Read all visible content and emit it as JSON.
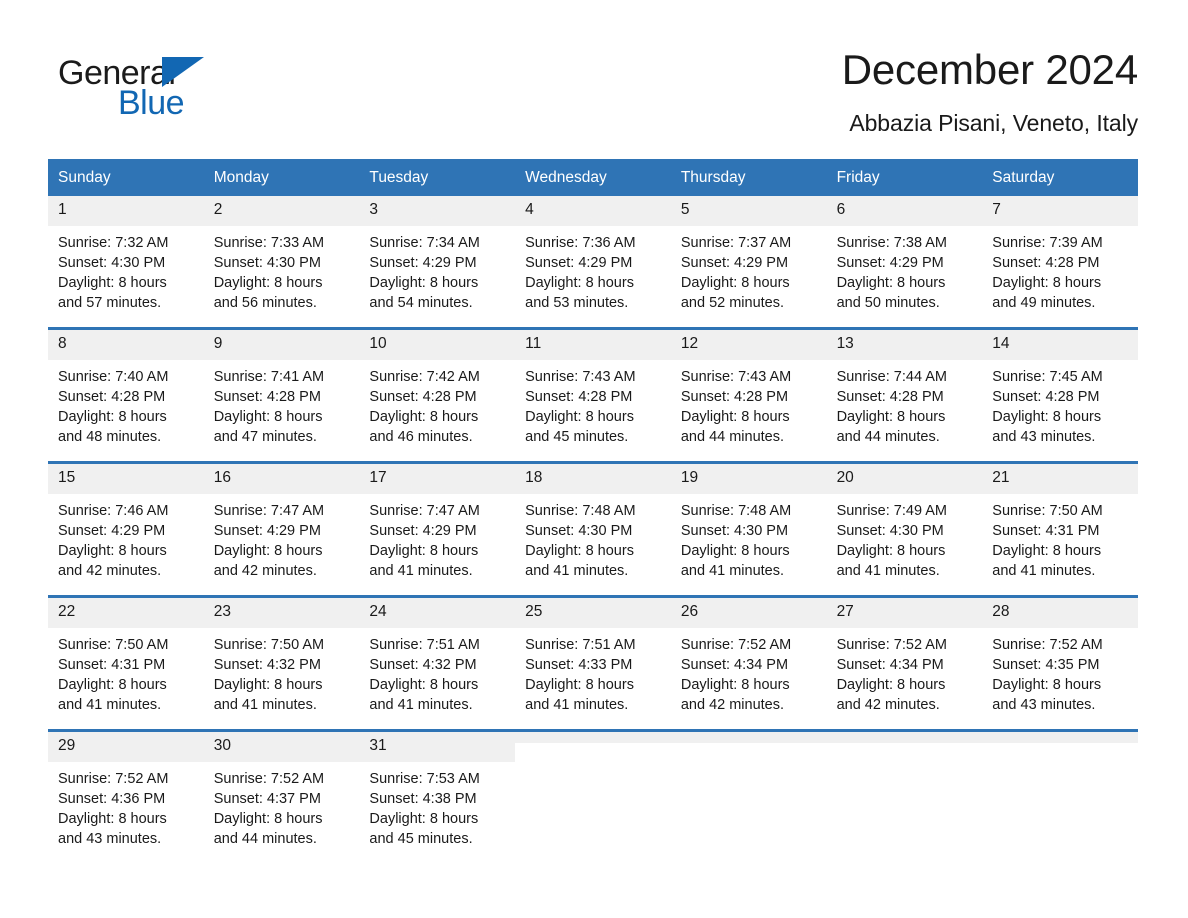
{
  "brand": {
    "word_one": "General",
    "word_two": "Blue",
    "triangle_icon": "brand-triangle-icon",
    "accent_color": "#1267b3"
  },
  "header": {
    "title": "December 2024",
    "subtitle": "Abbazia Pisani, Veneto, Italy"
  },
  "theme": {
    "header_blue": "#2f74b5",
    "day_band_gray": "#f0f0f0",
    "text": "#1a1a1a"
  },
  "calendar": {
    "weekday_headers": [
      "Sunday",
      "Monday",
      "Tuesday",
      "Wednesday",
      "Thursday",
      "Friday",
      "Saturday"
    ],
    "weeks": [
      [
        {
          "day": "1",
          "lines": [
            "Sunrise: 7:32 AM",
            "Sunset: 4:30 PM",
            "Daylight: 8 hours",
            "and 57 minutes."
          ]
        },
        {
          "day": "2",
          "lines": [
            "Sunrise: 7:33 AM",
            "Sunset: 4:30 PM",
            "Daylight: 8 hours",
            "and 56 minutes."
          ]
        },
        {
          "day": "3",
          "lines": [
            "Sunrise: 7:34 AM",
            "Sunset: 4:29 PM",
            "Daylight: 8 hours",
            "and 54 minutes."
          ]
        },
        {
          "day": "4",
          "lines": [
            "Sunrise: 7:36 AM",
            "Sunset: 4:29 PM",
            "Daylight: 8 hours",
            "and 53 minutes."
          ]
        },
        {
          "day": "5",
          "lines": [
            "Sunrise: 7:37 AM",
            "Sunset: 4:29 PM",
            "Daylight: 8 hours",
            "and 52 minutes."
          ]
        },
        {
          "day": "6",
          "lines": [
            "Sunrise: 7:38 AM",
            "Sunset: 4:29 PM",
            "Daylight: 8 hours",
            "and 50 minutes."
          ]
        },
        {
          "day": "7",
          "lines": [
            "Sunrise: 7:39 AM",
            "Sunset: 4:28 PM",
            "Daylight: 8 hours",
            "and 49 minutes."
          ]
        }
      ],
      [
        {
          "day": "8",
          "lines": [
            "Sunrise: 7:40 AM",
            "Sunset: 4:28 PM",
            "Daylight: 8 hours",
            "and 48 minutes."
          ]
        },
        {
          "day": "9",
          "lines": [
            "Sunrise: 7:41 AM",
            "Sunset: 4:28 PM",
            "Daylight: 8 hours",
            "and 47 minutes."
          ]
        },
        {
          "day": "10",
          "lines": [
            "Sunrise: 7:42 AM",
            "Sunset: 4:28 PM",
            "Daylight: 8 hours",
            "and 46 minutes."
          ]
        },
        {
          "day": "11",
          "lines": [
            "Sunrise: 7:43 AM",
            "Sunset: 4:28 PM",
            "Daylight: 8 hours",
            "and 45 minutes."
          ]
        },
        {
          "day": "12",
          "lines": [
            "Sunrise: 7:43 AM",
            "Sunset: 4:28 PM",
            "Daylight: 8 hours",
            "and 44 minutes."
          ]
        },
        {
          "day": "13",
          "lines": [
            "Sunrise: 7:44 AM",
            "Sunset: 4:28 PM",
            "Daylight: 8 hours",
            "and 44 minutes."
          ]
        },
        {
          "day": "14",
          "lines": [
            "Sunrise: 7:45 AM",
            "Sunset: 4:28 PM",
            "Daylight: 8 hours",
            "and 43 minutes."
          ]
        }
      ],
      [
        {
          "day": "15",
          "lines": [
            "Sunrise: 7:46 AM",
            "Sunset: 4:29 PM",
            "Daylight: 8 hours",
            "and 42 minutes."
          ]
        },
        {
          "day": "16",
          "lines": [
            "Sunrise: 7:47 AM",
            "Sunset: 4:29 PM",
            "Daylight: 8 hours",
            "and 42 minutes."
          ]
        },
        {
          "day": "17",
          "lines": [
            "Sunrise: 7:47 AM",
            "Sunset: 4:29 PM",
            "Daylight: 8 hours",
            "and 41 minutes."
          ]
        },
        {
          "day": "18",
          "lines": [
            "Sunrise: 7:48 AM",
            "Sunset: 4:30 PM",
            "Daylight: 8 hours",
            "and 41 minutes."
          ]
        },
        {
          "day": "19",
          "lines": [
            "Sunrise: 7:48 AM",
            "Sunset: 4:30 PM",
            "Daylight: 8 hours",
            "and 41 minutes."
          ]
        },
        {
          "day": "20",
          "lines": [
            "Sunrise: 7:49 AM",
            "Sunset: 4:30 PM",
            "Daylight: 8 hours",
            "and 41 minutes."
          ]
        },
        {
          "day": "21",
          "lines": [
            "Sunrise: 7:50 AM",
            "Sunset: 4:31 PM",
            "Daylight: 8 hours",
            "and 41 minutes."
          ]
        }
      ],
      [
        {
          "day": "22",
          "lines": [
            "Sunrise: 7:50 AM",
            "Sunset: 4:31 PM",
            "Daylight: 8 hours",
            "and 41 minutes."
          ]
        },
        {
          "day": "23",
          "lines": [
            "Sunrise: 7:50 AM",
            "Sunset: 4:32 PM",
            "Daylight: 8 hours",
            "and 41 minutes."
          ]
        },
        {
          "day": "24",
          "lines": [
            "Sunrise: 7:51 AM",
            "Sunset: 4:32 PM",
            "Daylight: 8 hours",
            "and 41 minutes."
          ]
        },
        {
          "day": "25",
          "lines": [
            "Sunrise: 7:51 AM",
            "Sunset: 4:33 PM",
            "Daylight: 8 hours",
            "and 41 minutes."
          ]
        },
        {
          "day": "26",
          "lines": [
            "Sunrise: 7:52 AM",
            "Sunset: 4:34 PM",
            "Daylight: 8 hours",
            "and 42 minutes."
          ]
        },
        {
          "day": "27",
          "lines": [
            "Sunrise: 7:52 AM",
            "Sunset: 4:34 PM",
            "Daylight: 8 hours",
            "and 42 minutes."
          ]
        },
        {
          "day": "28",
          "lines": [
            "Sunrise: 7:52 AM",
            "Sunset: 4:35 PM",
            "Daylight: 8 hours",
            "and 43 minutes."
          ]
        }
      ],
      [
        {
          "day": "29",
          "lines": [
            "Sunrise: 7:52 AM",
            "Sunset: 4:36 PM",
            "Daylight: 8 hours",
            "and 43 minutes."
          ]
        },
        {
          "day": "30",
          "lines": [
            "Sunrise: 7:52 AM",
            "Sunset: 4:37 PM",
            "Daylight: 8 hours",
            "and 44 minutes."
          ]
        },
        {
          "day": "31",
          "lines": [
            "Sunrise: 7:53 AM",
            "Sunset: 4:38 PM",
            "Daylight: 8 hours",
            "and 45 minutes."
          ]
        },
        {
          "day": "",
          "lines": []
        },
        {
          "day": "",
          "lines": []
        },
        {
          "day": "",
          "lines": []
        },
        {
          "day": "",
          "lines": []
        }
      ]
    ]
  }
}
